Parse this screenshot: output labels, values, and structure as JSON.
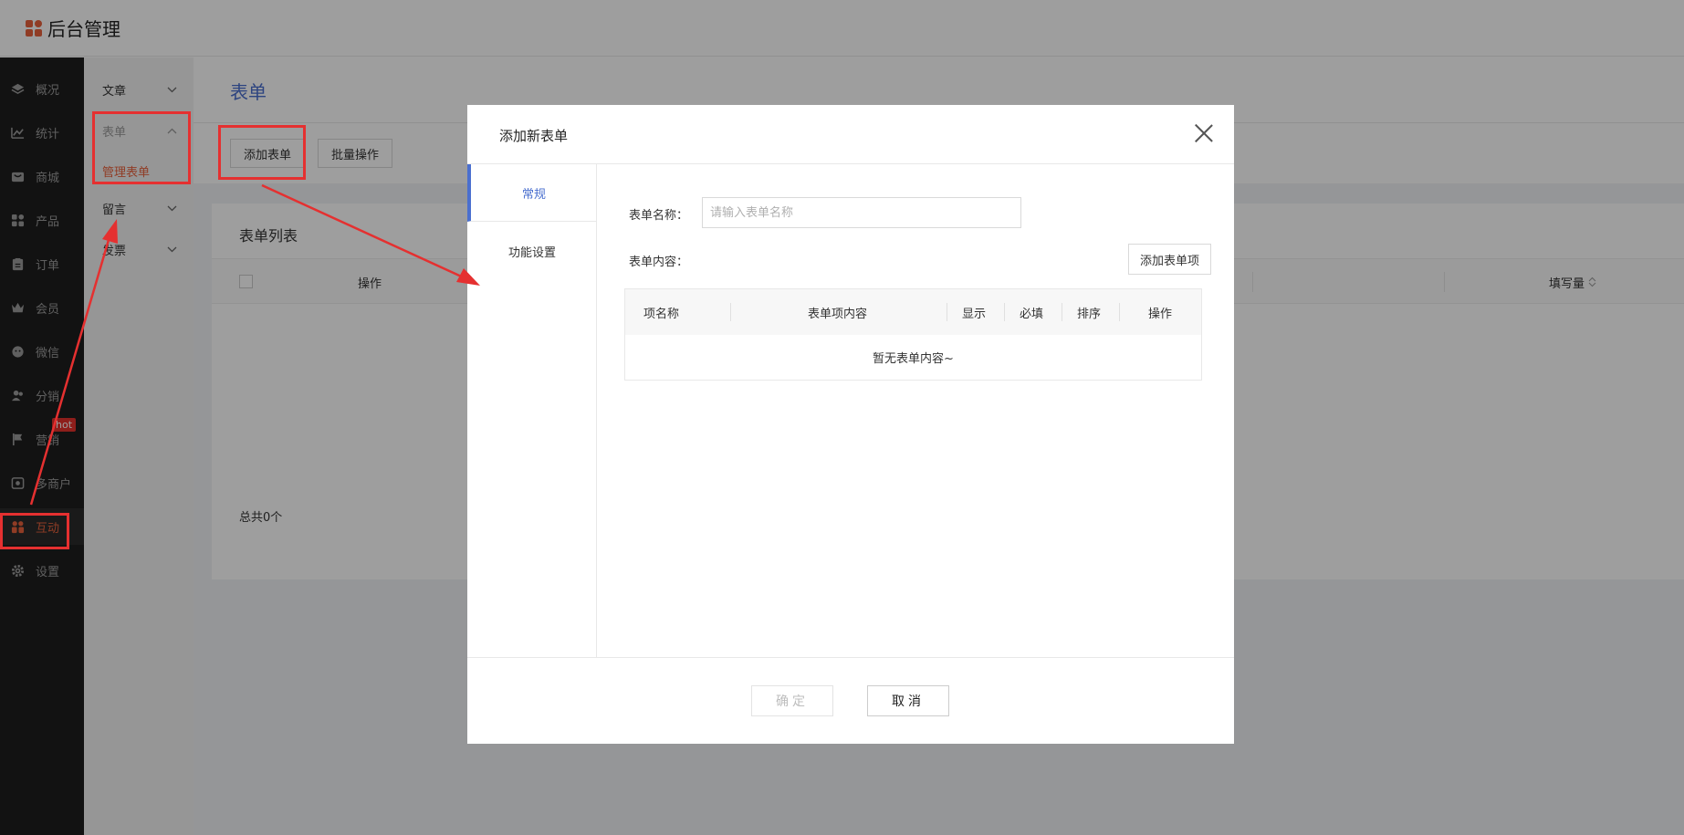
{
  "header": {
    "title": "后台管理"
  },
  "sidebar": {
    "items": [
      {
        "label": "概况",
        "icon": "layers-icon"
      },
      {
        "label": "统计",
        "icon": "chart-icon"
      },
      {
        "label": "商城",
        "icon": "shop-icon"
      },
      {
        "label": "产品",
        "icon": "grid-icon"
      },
      {
        "label": "订单",
        "icon": "clipboard-icon"
      },
      {
        "label": "会员",
        "icon": "crown-icon"
      },
      {
        "label": "微信",
        "icon": "wechat-icon"
      },
      {
        "label": "分销",
        "icon": "users-icon"
      },
      {
        "label": "营销",
        "icon": "flag-icon"
      },
      {
        "label": "多商户",
        "icon": "store-icon"
      },
      {
        "label": "互动",
        "icon": "interact-icon"
      },
      {
        "label": "设置",
        "icon": "gear-icon"
      }
    ],
    "hot_badge": "hot"
  },
  "subnav": {
    "items": [
      {
        "label": "文章"
      },
      {
        "label": "表单"
      },
      {
        "label": "留言"
      },
      {
        "label": "发票"
      }
    ],
    "active_child": "管理表单"
  },
  "main": {
    "page_title": "表单",
    "toolbar": {
      "add_label": "添加表单",
      "batch_label": "批量操作"
    },
    "card_title": "表单列表",
    "columns": {
      "op": "操作",
      "fill": "填写量"
    },
    "total": "总共0个"
  },
  "modal": {
    "title": "添加新表单",
    "tabs": [
      "常规",
      "功能设置"
    ],
    "name_label": "表单名称：",
    "name_placeholder": "请输入表单名称",
    "content_label": "表单内容：",
    "add_item_label": "添加表单项",
    "table_columns": [
      "项名称",
      "表单项内容",
      "显示",
      "必填",
      "排序",
      "操作"
    ],
    "empty_text": "暂无表单内容~",
    "ok_label": "确定",
    "cancel_label": "取消"
  },
  "colors": {
    "accent": "#4a6fcf",
    "active": "#e8623c",
    "annotation": "#e53030",
    "sidebar_bg": "#1d1d1d"
  }
}
